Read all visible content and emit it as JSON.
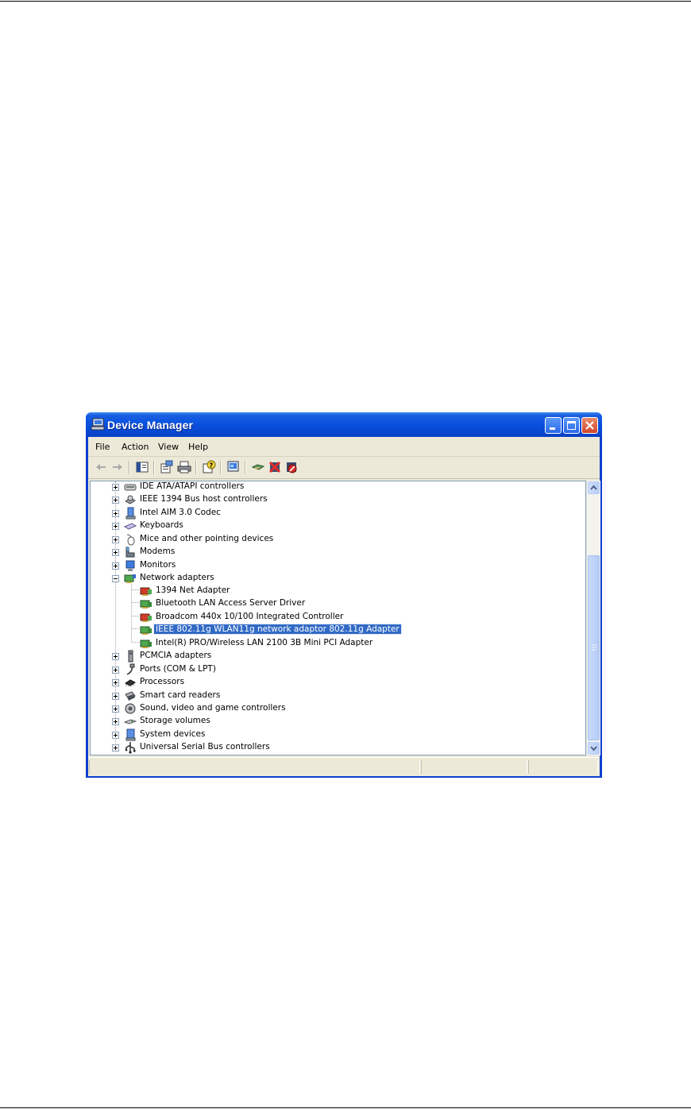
{
  "window": {
    "title": "Device Manager",
    "accent": "#0a52e0"
  },
  "menu": [
    {
      "label": "File"
    },
    {
      "label": "Action"
    },
    {
      "label": "View"
    },
    {
      "label": "Help"
    }
  ],
  "toolbar": {
    "buttons": [
      "back-arrow-icon",
      "forward-arrow-icon",
      "show-hide-console-tree-icon",
      "properties-icon",
      "print-icon",
      "help-icon",
      "scan-hardware-icon",
      "update-driver-icon",
      "uninstall-icon",
      "disable-icon"
    ]
  },
  "tree": {
    "items": [
      {
        "label": "IDE ATA/ATAPI controllers",
        "level": 0,
        "state": "collapsed",
        "icon": "ide-controller-icon"
      },
      {
        "label": "IEEE 1394 Bus host controllers",
        "level": 0,
        "state": "collapsed",
        "icon": "firewire-controller-icon"
      },
      {
        "label": "Intel AIM 3.0 Codec",
        "level": 0,
        "state": "collapsed",
        "icon": "codec-icon"
      },
      {
        "label": "Keyboards",
        "level": 0,
        "state": "collapsed",
        "icon": "keyboard-icon"
      },
      {
        "label": "Mice and other pointing devices",
        "level": 0,
        "state": "collapsed",
        "icon": "mouse-icon"
      },
      {
        "label": "Modems",
        "level": 0,
        "state": "collapsed",
        "icon": "modem-icon"
      },
      {
        "label": "Monitors",
        "level": 0,
        "state": "collapsed",
        "icon": "monitor-icon"
      },
      {
        "label": "Network adapters",
        "level": 0,
        "state": "expanded",
        "icon": "network-adapter-icon"
      },
      {
        "label": "1394 Net Adapter",
        "level": 1,
        "icon": "network-card-disabled-icon"
      },
      {
        "label": "Bluetooth LAN Access Server Driver",
        "level": 1,
        "icon": "network-card-icon"
      },
      {
        "label": "Broadcom 440x 10/100 Integrated Controller",
        "level": 1,
        "icon": "network-card-disabled-icon"
      },
      {
        "label": "IEEE 802.11g WLAN11g network adaptor 802.11g Adapter",
        "level": 1,
        "icon": "network-card-icon",
        "selected": true
      },
      {
        "label": "Intel(R) PRO/Wireless LAN 2100 3B Mini PCI Adapter",
        "level": 1,
        "icon": "network-card-icon"
      },
      {
        "label": "PCMCIA adapters",
        "level": 0,
        "state": "collapsed",
        "icon": "pcmcia-icon"
      },
      {
        "label": "Ports (COM & LPT)",
        "level": 0,
        "state": "collapsed",
        "icon": "port-icon"
      },
      {
        "label": "Processors",
        "level": 0,
        "state": "collapsed",
        "icon": "processor-icon"
      },
      {
        "label": "Smart card readers",
        "level": 0,
        "state": "collapsed",
        "icon": "smart-card-reader-icon"
      },
      {
        "label": "Sound, video and game controllers",
        "level": 0,
        "state": "collapsed",
        "icon": "sound-icon"
      },
      {
        "label": "Storage volumes",
        "level": 0,
        "state": "collapsed",
        "icon": "storage-volume-icon"
      },
      {
        "label": "System devices",
        "level": 0,
        "state": "collapsed",
        "icon": "system-device-icon"
      },
      {
        "label": "Universal Serial Bus controllers",
        "level": 0,
        "state": "collapsed",
        "icon": "usb-icon"
      }
    ]
  },
  "statusbar": {
    "segments": [
      "",
      "",
      ""
    ]
  }
}
